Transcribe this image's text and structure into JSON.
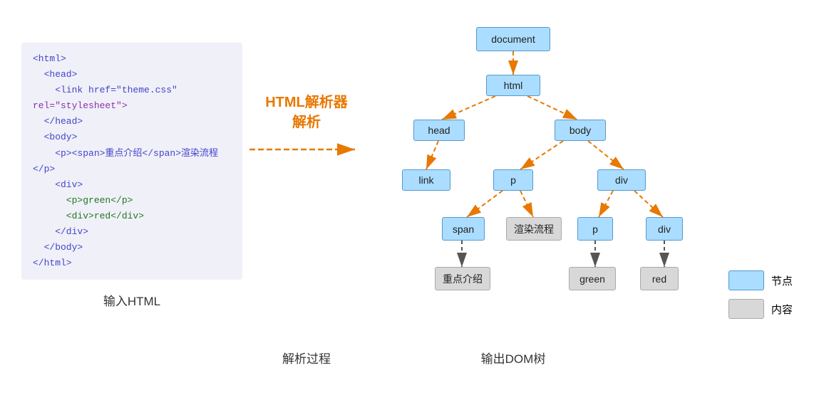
{
  "left": {
    "label": "输入HTML",
    "code_lines": [
      {
        "text": "<html>",
        "class": "code-blue"
      },
      {
        "text": "  <head>",
        "class": "code-blue"
      },
      {
        "text": "    <link href=\"theme.css\"",
        "class": "code-blue"
      },
      {
        "text": "rel=\"stylesheet\">",
        "class": "code-purple"
      },
      {
        "text": "  </head>",
        "class": "code-blue"
      },
      {
        "text": "  <body>",
        "class": "code-blue"
      },
      {
        "text": "    <p><span>重点介绍</span>渲染流程</p>",
        "class": "code-blue"
      },
      {
        "text": "    <div>",
        "class": "code-blue"
      },
      {
        "text": "      <p>green</p>",
        "class": "code-green"
      },
      {
        "text": "      <div>red</div>",
        "class": "code-green"
      },
      {
        "text": "    </div>",
        "class": "code-blue"
      },
      {
        "text": "  </body>",
        "class": "code-blue"
      },
      {
        "text": "</html>",
        "class": "code-blue"
      }
    ]
  },
  "middle": {
    "parser_label": "HTML解析器\n解析",
    "process_label": "解析过程"
  },
  "right": {
    "label": "输出DOM树",
    "nodes": {
      "document": "document",
      "html": "html",
      "head": "head",
      "body": "body",
      "link": "link",
      "p": "p",
      "div": "div",
      "span": "span",
      "render_text": "渲染流程",
      "p2": "p",
      "div2": "div",
      "zd_jj": "重点介绍",
      "green": "green",
      "red": "red"
    }
  },
  "legend": {
    "items": [
      {
        "label": "节点",
        "type": "node"
      },
      {
        "label": "内容",
        "type": "content"
      }
    ]
  }
}
